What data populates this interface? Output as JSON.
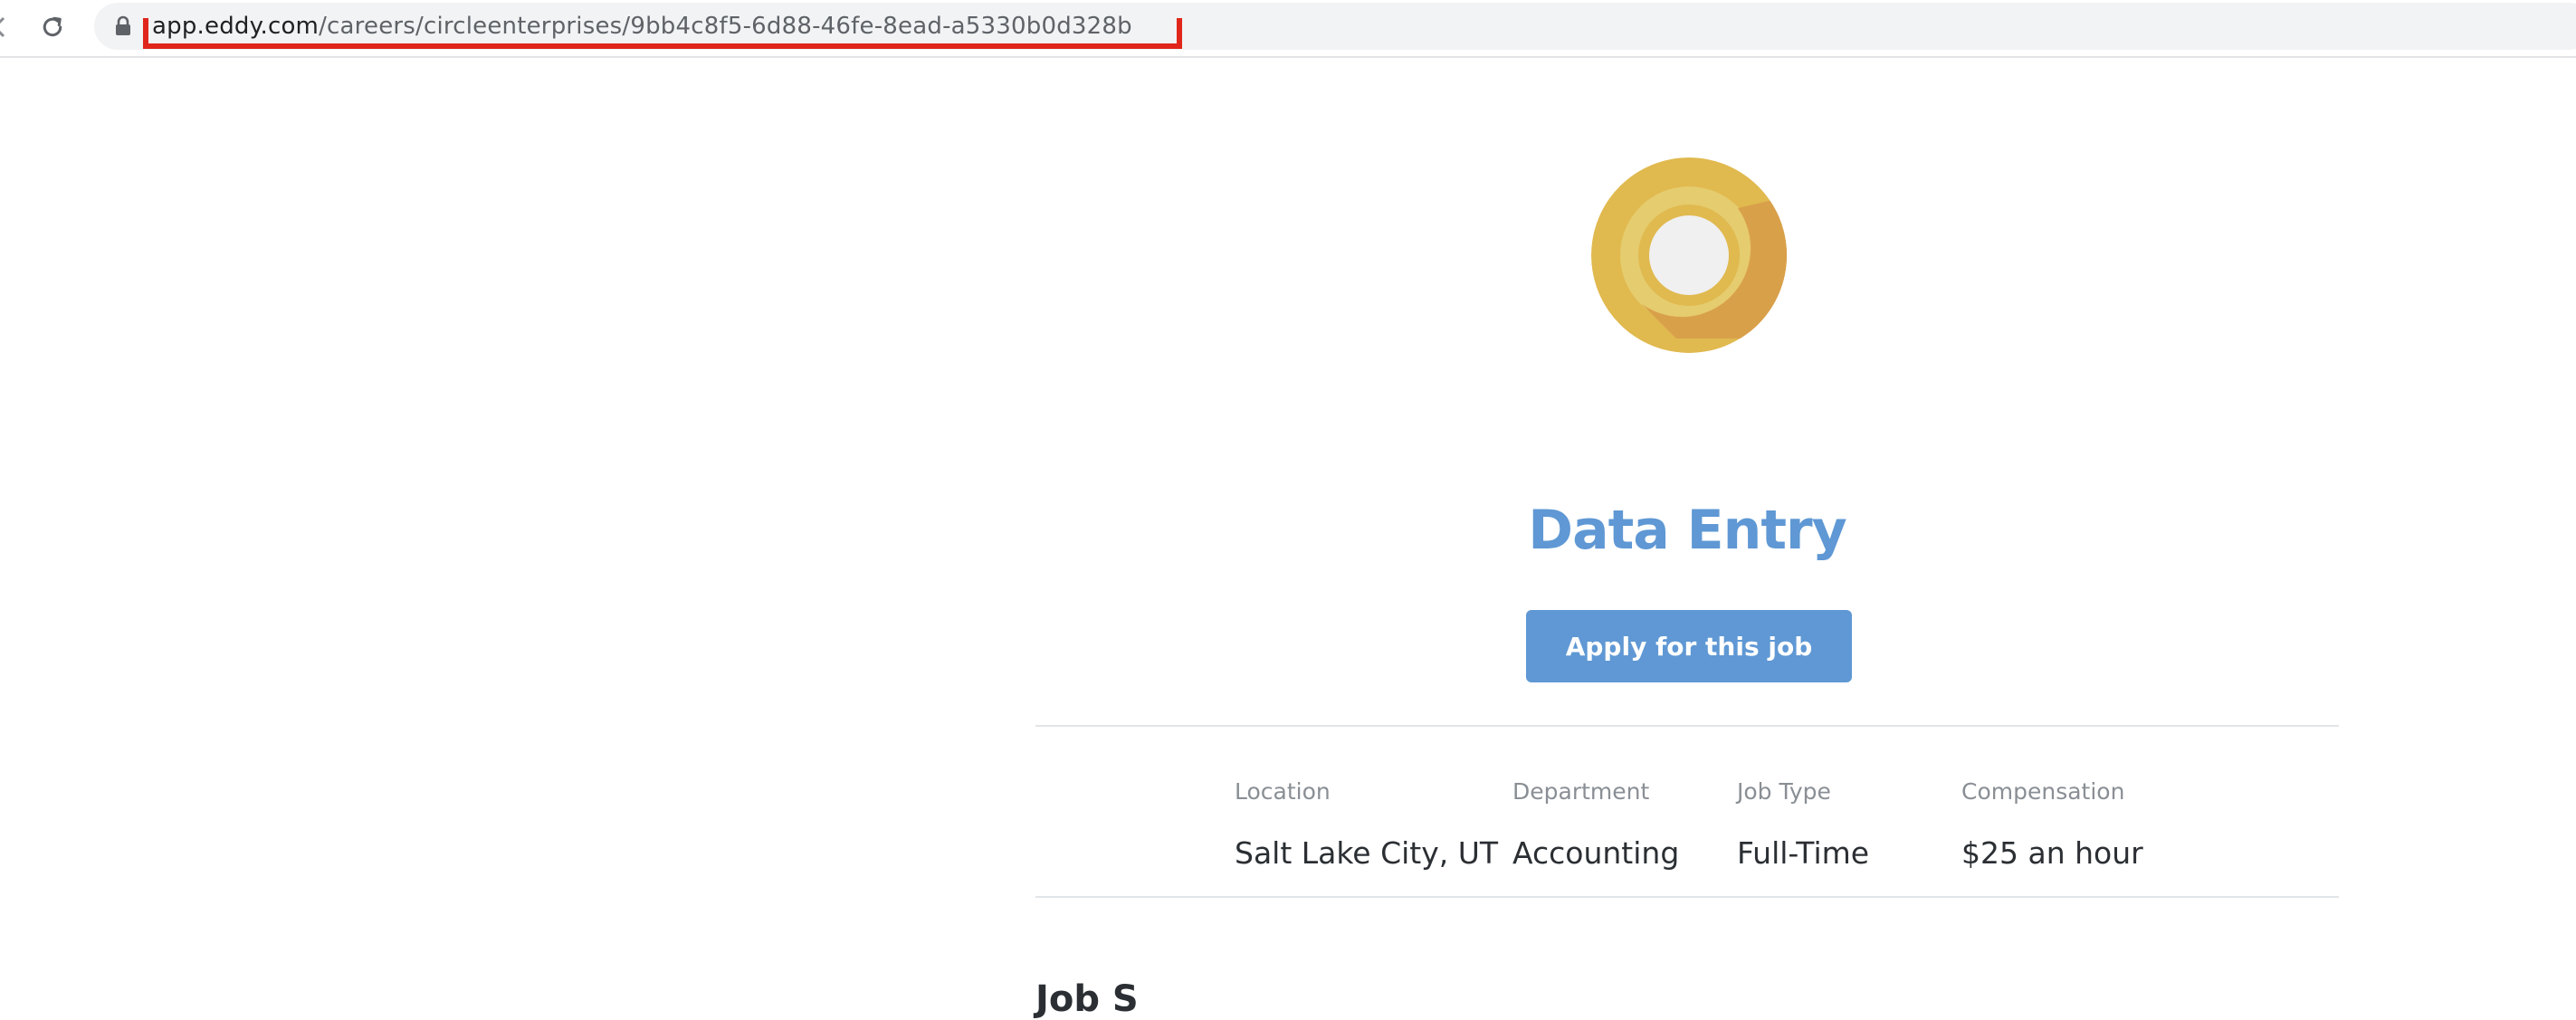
{
  "browser": {
    "url_host": "app.eddy.com",
    "url_path": "/careers/circleenterprises/9bb4c8f5-6d88-46fe-8ead-a5330b0d328b",
    "icons": {
      "back": "back-arrow-icon",
      "reload": "reload-icon",
      "lock": "lock-icon"
    },
    "highlight_color": "#e0261b"
  },
  "company": {
    "logo_icon": "circle-enterprises-logo",
    "logo_colors": [
      "#e0b94f",
      "#e5cc6e",
      "#d9a04a",
      "#f0f0f0"
    ]
  },
  "job": {
    "title": "Data Entry",
    "apply_label": "Apply for this job",
    "accent_color": "#5f98d4",
    "details": [
      {
        "label": "Location",
        "value": "Salt Lake City, UT"
      },
      {
        "label": "Department",
        "value": "Accounting"
      },
      {
        "label": "Job Type",
        "value": "Full-Time"
      },
      {
        "label": "Compensation",
        "value": "$25 an hour"
      }
    ]
  },
  "next_section": {
    "heading_partial": "Job S"
  }
}
